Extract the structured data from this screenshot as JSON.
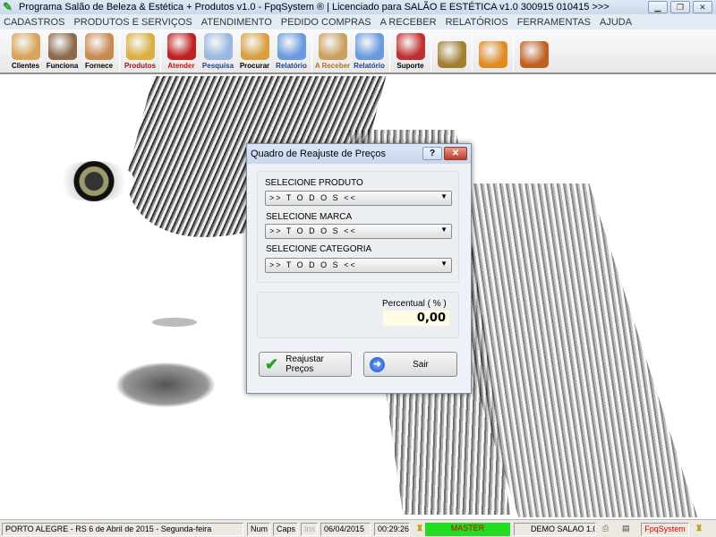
{
  "window": {
    "title": "Programa Salão de Beleza & Estética + Produtos v1.0 - FpqSystem ® | Licenciado para  SALÃO E ESTÉTICA v1.0 300915 010415 >>>"
  },
  "menu": [
    "CADASTROS",
    "PRODUTOS E SERVIÇOS",
    "ATENDIMENTO",
    "PEDIDO COMPRAS",
    "A RECEBER",
    "RELATÓRIOS",
    "FERRAMENTAS",
    "AJUDA"
  ],
  "toolbar": [
    {
      "label": "Clientes",
      "color": "#000000",
      "icon": "clients-icon"
    },
    {
      "label": "Funciona",
      "color": "#000000",
      "icon": "employees-icon"
    },
    {
      "label": "Fornece",
      "color": "#000000",
      "icon": "supplier-icon"
    },
    {
      "label": "Produtos",
      "color": "#a01010",
      "icon": "boxes-icon"
    },
    {
      "label": "Atender",
      "color": "#c01010",
      "icon": "service-icon"
    },
    {
      "label": "Pesquisa",
      "color": "#1a3f8f",
      "icon": "search-icon"
    },
    {
      "label": "Procurar",
      "color": "#000000",
      "icon": "drawer-icon"
    },
    {
      "label": "Relatório",
      "color": "#1a3f8f",
      "icon": "report-icon"
    },
    {
      "label": "A Receber",
      "color": "#b07020",
      "icon": "money-icon"
    },
    {
      "label": "Relatório",
      "color": "#1a3f8f",
      "icon": "report-icon"
    },
    {
      "label": "Suporte",
      "color": "#000000",
      "icon": "support-icon"
    },
    {
      "label": "",
      "color": "#000000",
      "icon": "coin-icon"
    },
    {
      "label": "",
      "color": "#000000",
      "icon": "calculator-icon"
    },
    {
      "label": "",
      "color": "#000000",
      "icon": "exit-door-icon"
    }
  ],
  "dialog": {
    "title": "Quadro de Reajuste de Preços",
    "help": "?",
    "close": "✕",
    "produto_label": "SELECIONE PRODUTO",
    "produto_value": ">> T O D O S <<",
    "marca_label": "SELECIONE MARCA",
    "marca_value": ">> T O D O S <<",
    "categoria_label": "SELECIONE CATEGORIA",
    "categoria_value": ">> T O D O S <<",
    "percentual_label": "Percentual ( % )",
    "percentual_value": "0,00",
    "reajustar_label": "Reajustar Preços",
    "sair_label": "Sair"
  },
  "status": {
    "location": "PORTO ALEGRE - RS  6 de Abril de 2015 - Segunda-feira",
    "num": "Num",
    "caps": "Caps",
    "ins": "Ins",
    "date": "06/04/2015",
    "time": "00:29:26",
    "user": "MASTER",
    "version": "DEMO SALAO 1.0",
    "brand": "FpqSystem"
  }
}
